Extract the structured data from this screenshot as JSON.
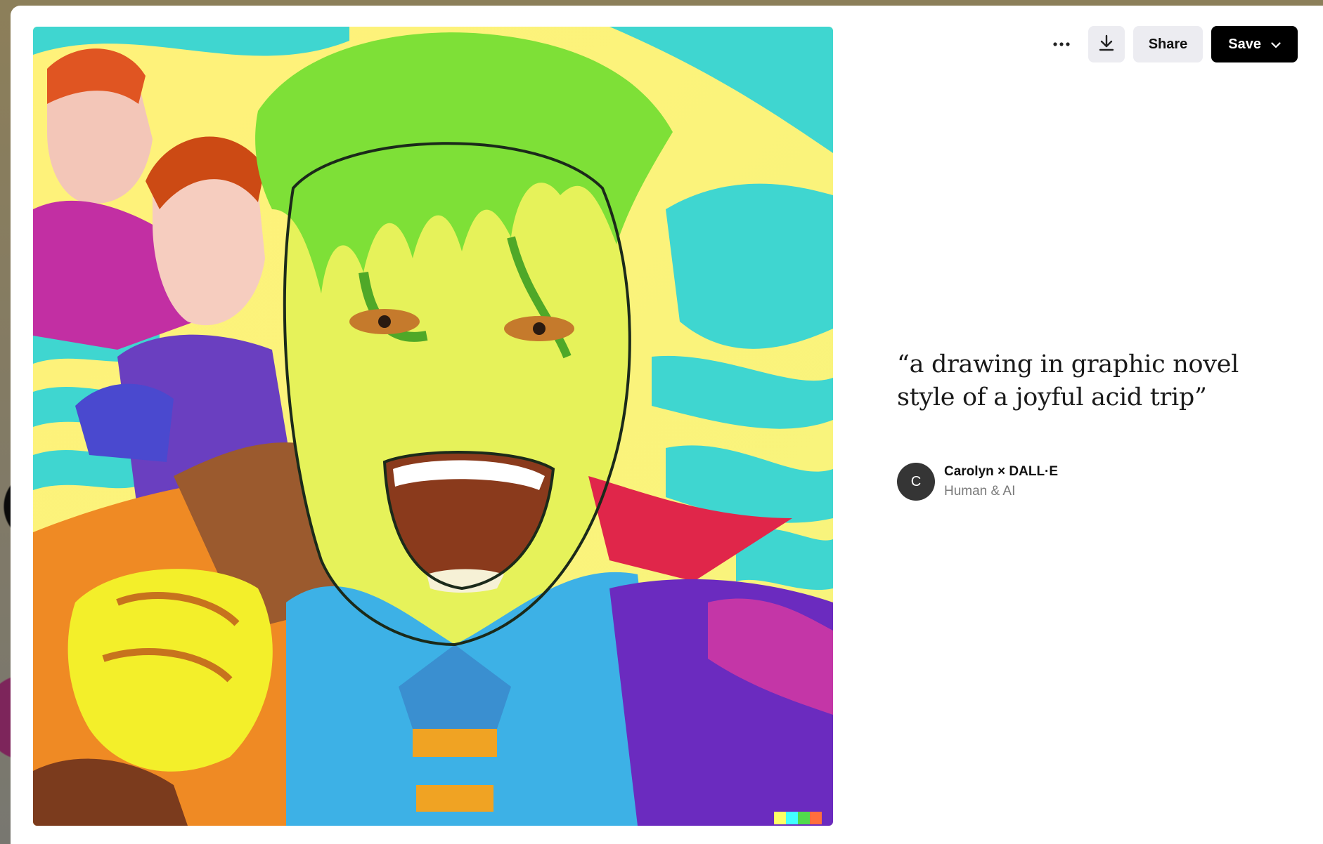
{
  "toolbar": {
    "more_icon": "more-horizontal-icon",
    "download_icon": "download-icon",
    "share_label": "Share",
    "save_label": "Save",
    "save_chevron_icon": "chevron-down-icon"
  },
  "artwork": {
    "signature_colors": [
      "#ffff66",
      "#42ffff",
      "#51da4c",
      "#ff6e3c",
      "#3c46ff"
    ]
  },
  "prompt": {
    "text": "“a drawing in graphic novel style of a joyful acid trip”"
  },
  "author": {
    "initial": "C",
    "name": "Carolyn × DALL·E",
    "subtitle": "Human & AI"
  }
}
